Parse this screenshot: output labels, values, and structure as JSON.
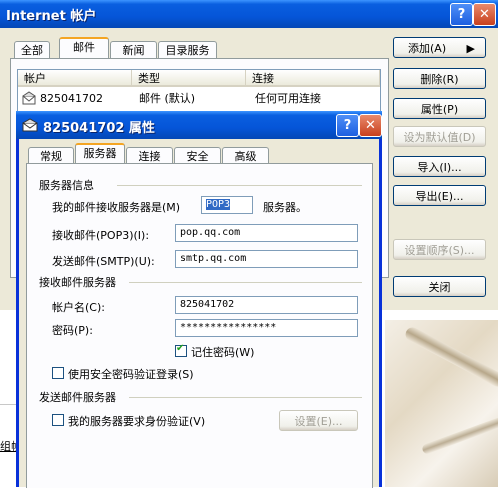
{
  "accounts_window": {
    "title": "Internet 帐户",
    "help_btn": "?",
    "close_btn": "✕",
    "tabs": [
      "全部",
      "邮件",
      "新闻",
      "目录服务"
    ],
    "active_tab": "邮件",
    "columns": [
      "帐户",
      "类型",
      "连接"
    ],
    "rows": [
      {
        "account": "825041702",
        "type": "邮件 (默认)",
        "connection": "任何可用连接"
      }
    ],
    "buttons": {
      "add": "添加(A)",
      "add_arrow": "▶",
      "remove": "删除(R)",
      "properties": "属性(P)",
      "set_default": "设为默认值(D)",
      "import": "导入(I)...",
      "export": "导出(E)...",
      "set_order": "设置顺序(S)...",
      "close": "关闭"
    }
  },
  "properties_dialog": {
    "title": "825041702 属性",
    "help_btn": "?",
    "close_btn": "✕",
    "tabs": [
      "常规",
      "服务器",
      "连接",
      "安全",
      "高级"
    ],
    "active_tab": "服务器",
    "server_info": {
      "heading": "服务器信息",
      "incoming_type_prefix": "我的邮件接收服务器是(M)",
      "incoming_type_value": "POP3",
      "incoming_type_suffix": "服务器。",
      "pop3_label": "接收邮件(POP3)(I):",
      "pop3_value": "pop.qq.com",
      "smtp_label": "发送邮件(SMTP)(U):",
      "smtp_value": "smtp.qq.com"
    },
    "incoming_server": {
      "heading": "接收邮件服务器",
      "account_label": "帐户名(C):",
      "account_value": "825041702",
      "password_label": "密码(P):",
      "password_value": "****************",
      "remember_label": "记住密码(W)",
      "remember_checked": true,
      "spa_label": "使用安全密码验证登录(S)",
      "spa_checked": false
    },
    "outgoing_server": {
      "heading": "发送邮件服务器",
      "auth_label": "我的服务器要求身份验证(V)",
      "auth_checked": false,
      "settings_button": "设置(E)..."
    }
  },
  "background": {
    "link_fragment": "组帧"
  }
}
